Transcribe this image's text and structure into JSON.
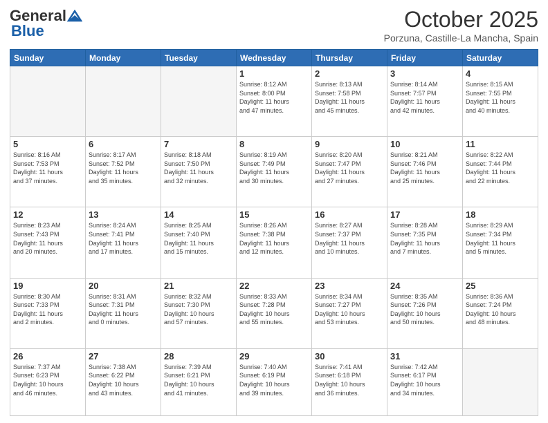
{
  "header": {
    "logo_general": "General",
    "logo_blue": "Blue",
    "month_title": "October 2025",
    "location": "Porzuna, Castille-La Mancha, Spain"
  },
  "weekdays": [
    "Sunday",
    "Monday",
    "Tuesday",
    "Wednesday",
    "Thursday",
    "Friday",
    "Saturday"
  ],
  "weeks": [
    [
      {
        "day": "",
        "info": ""
      },
      {
        "day": "",
        "info": ""
      },
      {
        "day": "",
        "info": ""
      },
      {
        "day": "1",
        "info": "Sunrise: 8:12 AM\nSunset: 8:00 PM\nDaylight: 11 hours\nand 47 minutes."
      },
      {
        "day": "2",
        "info": "Sunrise: 8:13 AM\nSunset: 7:58 PM\nDaylight: 11 hours\nand 45 minutes."
      },
      {
        "day": "3",
        "info": "Sunrise: 8:14 AM\nSunset: 7:57 PM\nDaylight: 11 hours\nand 42 minutes."
      },
      {
        "day": "4",
        "info": "Sunrise: 8:15 AM\nSunset: 7:55 PM\nDaylight: 11 hours\nand 40 minutes."
      }
    ],
    [
      {
        "day": "5",
        "info": "Sunrise: 8:16 AM\nSunset: 7:53 PM\nDaylight: 11 hours\nand 37 minutes."
      },
      {
        "day": "6",
        "info": "Sunrise: 8:17 AM\nSunset: 7:52 PM\nDaylight: 11 hours\nand 35 minutes."
      },
      {
        "day": "7",
        "info": "Sunrise: 8:18 AM\nSunset: 7:50 PM\nDaylight: 11 hours\nand 32 minutes."
      },
      {
        "day": "8",
        "info": "Sunrise: 8:19 AM\nSunset: 7:49 PM\nDaylight: 11 hours\nand 30 minutes."
      },
      {
        "day": "9",
        "info": "Sunrise: 8:20 AM\nSunset: 7:47 PM\nDaylight: 11 hours\nand 27 minutes."
      },
      {
        "day": "10",
        "info": "Sunrise: 8:21 AM\nSunset: 7:46 PM\nDaylight: 11 hours\nand 25 minutes."
      },
      {
        "day": "11",
        "info": "Sunrise: 8:22 AM\nSunset: 7:44 PM\nDaylight: 11 hours\nand 22 minutes."
      }
    ],
    [
      {
        "day": "12",
        "info": "Sunrise: 8:23 AM\nSunset: 7:43 PM\nDaylight: 11 hours\nand 20 minutes."
      },
      {
        "day": "13",
        "info": "Sunrise: 8:24 AM\nSunset: 7:41 PM\nDaylight: 11 hours\nand 17 minutes."
      },
      {
        "day": "14",
        "info": "Sunrise: 8:25 AM\nSunset: 7:40 PM\nDaylight: 11 hours\nand 15 minutes."
      },
      {
        "day": "15",
        "info": "Sunrise: 8:26 AM\nSunset: 7:38 PM\nDaylight: 11 hours\nand 12 minutes."
      },
      {
        "day": "16",
        "info": "Sunrise: 8:27 AM\nSunset: 7:37 PM\nDaylight: 11 hours\nand 10 minutes."
      },
      {
        "day": "17",
        "info": "Sunrise: 8:28 AM\nSunset: 7:35 PM\nDaylight: 11 hours\nand 7 minutes."
      },
      {
        "day": "18",
        "info": "Sunrise: 8:29 AM\nSunset: 7:34 PM\nDaylight: 11 hours\nand 5 minutes."
      }
    ],
    [
      {
        "day": "19",
        "info": "Sunrise: 8:30 AM\nSunset: 7:33 PM\nDaylight: 11 hours\nand 2 minutes."
      },
      {
        "day": "20",
        "info": "Sunrise: 8:31 AM\nSunset: 7:31 PM\nDaylight: 11 hours\nand 0 minutes."
      },
      {
        "day": "21",
        "info": "Sunrise: 8:32 AM\nSunset: 7:30 PM\nDaylight: 10 hours\nand 57 minutes."
      },
      {
        "day": "22",
        "info": "Sunrise: 8:33 AM\nSunset: 7:28 PM\nDaylight: 10 hours\nand 55 minutes."
      },
      {
        "day": "23",
        "info": "Sunrise: 8:34 AM\nSunset: 7:27 PM\nDaylight: 10 hours\nand 53 minutes."
      },
      {
        "day": "24",
        "info": "Sunrise: 8:35 AM\nSunset: 7:26 PM\nDaylight: 10 hours\nand 50 minutes."
      },
      {
        "day": "25",
        "info": "Sunrise: 8:36 AM\nSunset: 7:24 PM\nDaylight: 10 hours\nand 48 minutes."
      }
    ],
    [
      {
        "day": "26",
        "info": "Sunrise: 7:37 AM\nSunset: 6:23 PM\nDaylight: 10 hours\nand 46 minutes."
      },
      {
        "day": "27",
        "info": "Sunrise: 7:38 AM\nSunset: 6:22 PM\nDaylight: 10 hours\nand 43 minutes."
      },
      {
        "day": "28",
        "info": "Sunrise: 7:39 AM\nSunset: 6:21 PM\nDaylight: 10 hours\nand 41 minutes."
      },
      {
        "day": "29",
        "info": "Sunrise: 7:40 AM\nSunset: 6:19 PM\nDaylight: 10 hours\nand 39 minutes."
      },
      {
        "day": "30",
        "info": "Sunrise: 7:41 AM\nSunset: 6:18 PM\nDaylight: 10 hours\nand 36 minutes."
      },
      {
        "day": "31",
        "info": "Sunrise: 7:42 AM\nSunset: 6:17 PM\nDaylight: 10 hours\nand 34 minutes."
      },
      {
        "day": "",
        "info": ""
      }
    ]
  ]
}
